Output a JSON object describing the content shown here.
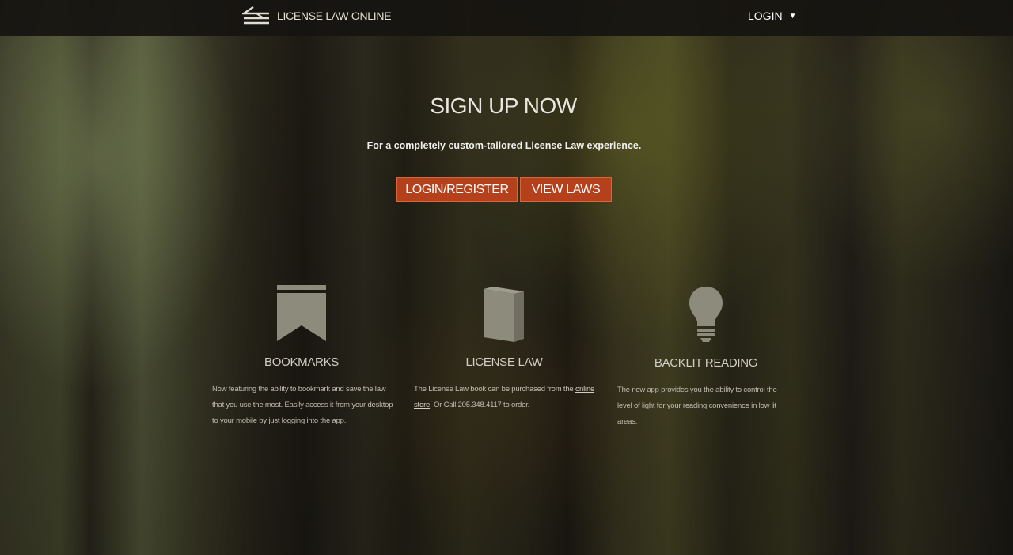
{
  "header": {
    "logo_text": "LICENSE LAW ONLINE",
    "login_label": "LOGIN",
    "login_caret": "▼"
  },
  "hero": {
    "title": "SIGN UP NOW",
    "subtitle": "For a completely custom-tailored License Law experience.",
    "login_register_label": "LOGIN/REGISTER",
    "view_laws_label": "VIEW LAWS"
  },
  "features": [
    {
      "icon": "bookmark-icon",
      "title": "BOOKMARKS",
      "text": "Now featuring the ability to bookmark and save the law that you use the most. Easily access it from your desktop to your mobile by just logging into the app."
    },
    {
      "icon": "book-icon",
      "title": "LICENSE LAW",
      "text_before": "The License Law book can be purchased from the ",
      "link_text": "online store",
      "text_after": ". Or Call 205.348.4117 to order."
    },
    {
      "icon": "lightbulb-icon",
      "title": "BACKLIT READING",
      "text": "The new app provides you the ability to control the level of light for your reading convenience in low lit areas."
    }
  ],
  "colors": {
    "accent": "#b5411c",
    "topbar": "#161411",
    "icon_fill": "#8c8b7c"
  }
}
